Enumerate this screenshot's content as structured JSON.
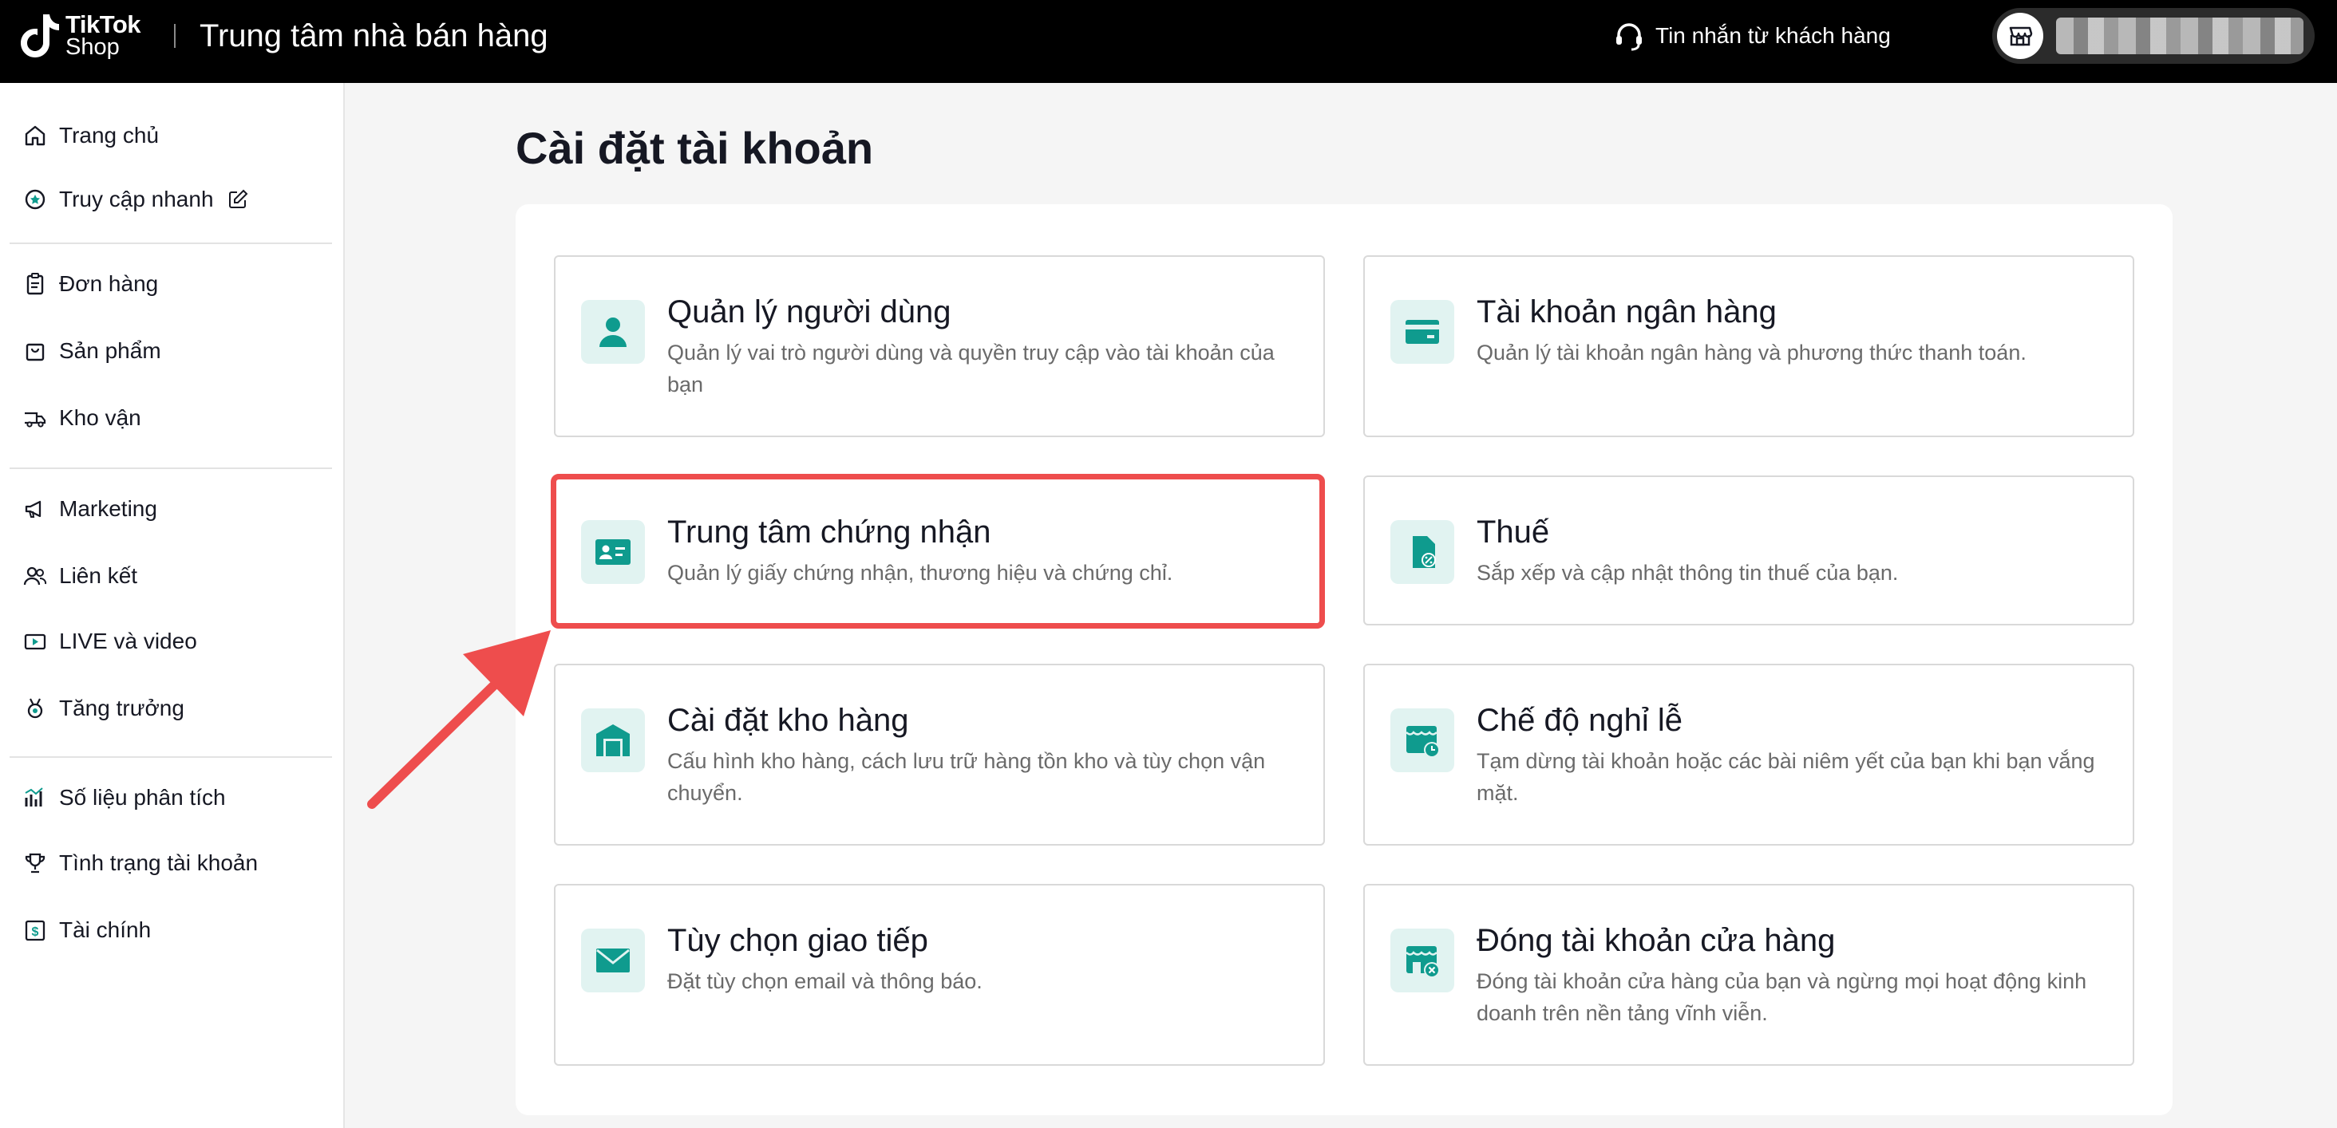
{
  "header": {
    "logo_line1": "TikTok",
    "logo_line2": "Shop",
    "title": "Trung tâm nhà bán hàng",
    "messages_label": "Tin nhắn từ khách hàng"
  },
  "sidebar": {
    "items": [
      {
        "label": "Trang chủ",
        "icon": "home-icon"
      },
      {
        "label": "Truy cập nhanh",
        "icon": "star-circle-icon"
      },
      {
        "label": "Đơn hàng",
        "icon": "clipboard-icon"
      },
      {
        "label": "Sản phẩm",
        "icon": "shopping-bag-icon"
      },
      {
        "label": "Kho vận",
        "icon": "delivery-truck-icon"
      },
      {
        "label": "Marketing",
        "icon": "megaphone-icon"
      },
      {
        "label": "Liên kết",
        "icon": "affiliate-users-icon"
      },
      {
        "label": "LIVE và video",
        "icon": "video-icon"
      },
      {
        "label": "Tăng trưởng",
        "icon": "growth-medal-icon"
      },
      {
        "label": "Số liệu phân tích",
        "icon": "analytics-bars-icon"
      },
      {
        "label": "Tình trạng tài khoản",
        "icon": "trophy-icon"
      },
      {
        "label": "Tài chính",
        "icon": "finance-dollar-icon"
      }
    ]
  },
  "main": {
    "page_title": "Cài đặt tài khoản",
    "cards": [
      {
        "title": "Quản lý người dùng",
        "desc": "Quản lý vai trò người dùng và quyền truy cập vào tài khoản của bạn",
        "icon": "user-icon"
      },
      {
        "title": "Tài khoản ngân hàng",
        "desc": "Quản lý tài khoản ngân hàng và phương thức thanh toán.",
        "icon": "bank-card-icon"
      },
      {
        "title": "Trung tâm chứng nhận",
        "desc": "Quản lý giấy chứng nhận, thương hiệu và chứng chỉ.",
        "icon": "id-card-icon"
      },
      {
        "title": "Thuế",
        "desc": "Sắp xếp và cập nhật thông tin thuế của bạn.",
        "icon": "tax-document-icon"
      },
      {
        "title": "Cài đặt kho hàng",
        "desc": "Cấu hình kho hàng, cách lưu trữ hàng tồn kho và tùy chọn vận chuyển.",
        "icon": "warehouse-icon"
      },
      {
        "title": "Chế độ nghỉ lễ",
        "desc": "Tạm dừng tài khoản hoặc các bài niêm yết của bạn khi bạn vắng mặt.",
        "icon": "store-clock-icon"
      },
      {
        "title": "Tùy chọn giao tiếp",
        "desc": "Đặt tùy chọn email và thông báo.",
        "icon": "envelope-icon"
      },
      {
        "title": "Đóng tài khoản cửa hàng",
        "desc": "Đóng tài khoản cửa hàng của bạn và ngừng mọi hoạt động kinh doanh trên nền tảng vĩnh viễn.",
        "icon": "store-close-icon"
      }
    ]
  },
  "colors": {
    "accent_teal": "#0f9b8e",
    "icon_bg": "#e1f3f1",
    "highlight_red": "#ee4d4d"
  }
}
